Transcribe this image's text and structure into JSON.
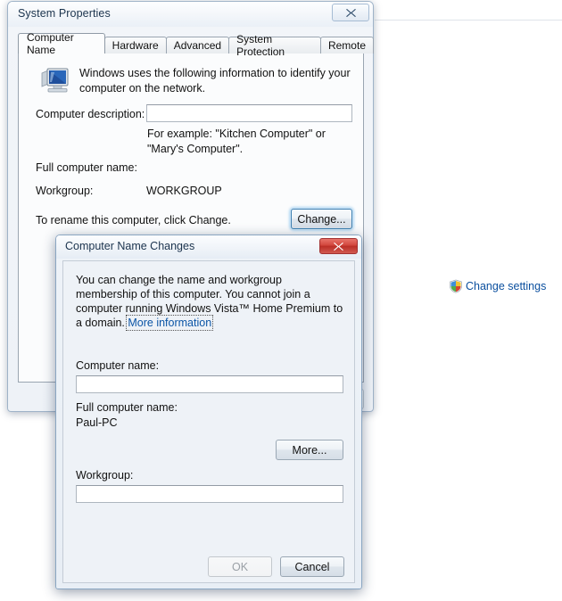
{
  "background": {
    "change_settings_link": "Change settings",
    "shield_icon": "uac-shield-icon"
  },
  "system_properties": {
    "title": "System Properties",
    "close_label": "✕",
    "tabs": [
      {
        "label": "Computer Name",
        "active": true
      },
      {
        "label": "Hardware",
        "active": false
      },
      {
        "label": "Advanced",
        "active": false
      },
      {
        "label": "System Protection",
        "active": false
      },
      {
        "label": "Remote",
        "active": false
      }
    ],
    "computer_icon": "computer-monitor-icon",
    "intro_text": "Windows uses the following information to identify your computer on the network.",
    "computer_description_label": "Computer description:",
    "computer_description_value": "",
    "computer_description_hint": "For example: \"Kitchen Computer\" or \"Mary's Computer\".",
    "full_computer_name_label": "Full computer name:",
    "full_computer_name_value": "",
    "workgroup_label": "Workgroup:",
    "workgroup_value": "WORKGROUP",
    "rename_hint": "To rename this computer, click Change.",
    "change_button": "Change..."
  },
  "computer_name_changes": {
    "title": "Computer Name Changes",
    "close_label": "✕",
    "description_part1": "You can change the name and workgroup membership of this computer. You cannot join a computer running Windows Vista™ Home Premium to a domain. ",
    "description_link": "More information",
    "computer_name_label": "Computer name:",
    "computer_name_value": "",
    "full_computer_name_label": "Full computer name:",
    "full_computer_name_value": "Paul-PC",
    "more_button": "More...",
    "workgroup_label": "Workgroup:",
    "workgroup_value": "",
    "ok_button": "OK",
    "ok_enabled": false,
    "cancel_button": "Cancel"
  },
  "colors": {
    "link": "#0b55a6",
    "titlebar_text": "#1b334d",
    "close_red": "#d2463c",
    "focus_blue": "#3c7fb1"
  }
}
